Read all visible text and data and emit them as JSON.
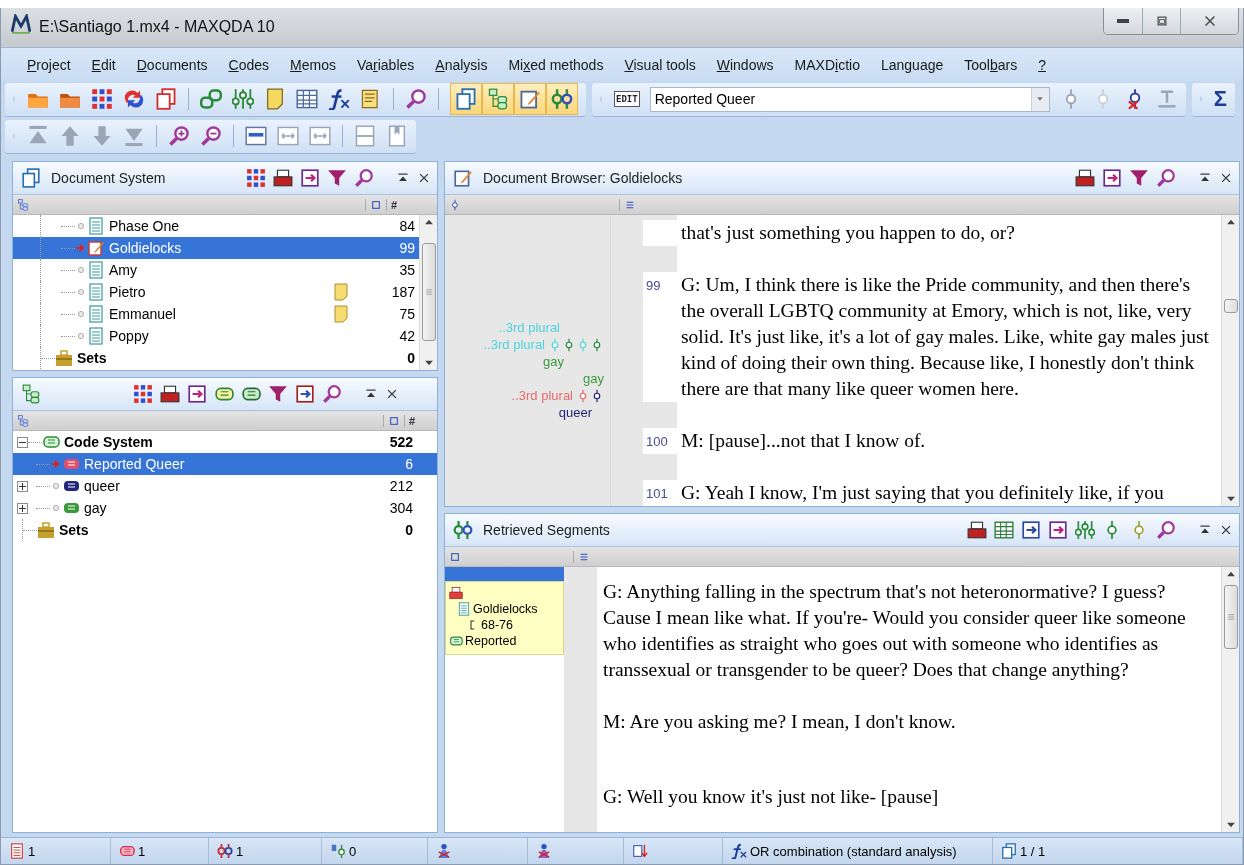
{
  "window": {
    "title": "E:\\Santiago 1.mx4 - MAXQDA 10"
  },
  "menu": [
    {
      "key": "P",
      "after": "roject"
    },
    {
      "key": "E",
      "after": "dit"
    },
    {
      "key": "D",
      "after": "ocuments"
    },
    {
      "key": "C",
      "after": "odes"
    },
    {
      "key": "M",
      "after": "emos"
    },
    {
      "before": "Va",
      "key": "r",
      "after": "iables"
    },
    {
      "key": "A",
      "after": "nalysis"
    },
    {
      "before": "Mi",
      "key": "x",
      "after": "ed methods"
    },
    {
      "key": "V",
      "after": "isual tools"
    },
    {
      "key": "W",
      "after": "indows"
    },
    {
      "before": "MAXD",
      "key": "i",
      "after": "ctio"
    },
    {
      "before": "Lan",
      "key": "g",
      "after": "uage"
    },
    {
      "before": "Tool",
      "key": "b",
      "after": "ars"
    },
    {
      "key": "?"
    }
  ],
  "toolbar": {
    "window_toggles": [
      {
        "on": true
      },
      {
        "on": true
      },
      {
        "on": true
      },
      {
        "on": true
      }
    ],
    "edit_badge": "EDIT",
    "active_code": "Reported Queer",
    "sigma": "Σ"
  },
  "document_system": {
    "title": "Document System",
    "count_header": "#",
    "items": [
      {
        "name": "Phase One",
        "count": "84",
        "selected": false,
        "memo": false
      },
      {
        "name": "Goldielocks",
        "count": "99",
        "selected": true,
        "memo": false
      },
      {
        "name": "Amy",
        "count": "35",
        "selected": false,
        "memo": false
      },
      {
        "name": "Pietro",
        "count": "187",
        "selected": false,
        "memo": true
      },
      {
        "name": "Emmanuel",
        "count": "75",
        "selected": false,
        "memo": true
      },
      {
        "name": "Poppy",
        "count": "42",
        "selected": false,
        "memo": false
      }
    ],
    "sets": {
      "name": "Sets",
      "count": "0"
    }
  },
  "code_system": {
    "count_header": "#",
    "root": {
      "name": "Code System",
      "count": "522",
      "expanded": true
    },
    "codes": [
      {
        "name": "Reported Queer",
        "count": "6",
        "selected": true,
        "color": "#e0506e"
      },
      {
        "name": "queer",
        "count": "212",
        "selected": false,
        "expanded": false,
        "color": "#24247a"
      },
      {
        "name": "gay",
        "count": "304",
        "selected": false,
        "expanded": false,
        "color": "#3a9a3a"
      }
    ],
    "sets": {
      "name": "Sets",
      "count": "0"
    }
  },
  "document_browser": {
    "title": "Document Browser: Goldielocks",
    "margin_marks": [
      {
        "label": "..3rd plural",
        "color": "#4fd3dc"
      },
      {
        "label": "..3rd plural",
        "color": "#4fd3dc",
        "symbols": [
          {
            "color": "#4fd3dc"
          },
          {
            "color": "#1f8a3a"
          },
          {
            "color": "#4fd3dc"
          },
          {
            "color": "#1f8a3a"
          }
        ]
      },
      {
        "label": "gay",
        "color": "#3a9a3a"
      },
      {
        "label": "gay",
        "color": "#3a9a3a"
      },
      {
        "label": "..3rd plural",
        "color": "#e86a6a",
        "symbols": [
          {
            "color": "#e86a6a"
          },
          {
            "color": "#24247a"
          }
        ]
      },
      {
        "label": "queer",
        "color": "#24247a"
      }
    ],
    "paragraphs": [
      {
        "text": "that's just something you happen to do, or?"
      },
      {
        "number": "99",
        "text": "G: Um, I think there is like the Pride community, and then there's the overall LGBTQ community at Emory, which is not, like, very solid. It's just like, it's a lot of gay males. Like, white gay males just kind of doing their own thing. Because like, I honestly don't think there are that many like queer women here."
      },
      {
        "number": "100",
        "text": "M: [pause]...not that I know of."
      },
      {
        "number": "101",
        "text": "G: Yeah I know, I'm just saying that you definitely like, if you"
      }
    ]
  },
  "retrieved_segments": {
    "title": "Retrieved Segments",
    "source": {
      "document": "Goldielocks",
      "range": "68-76",
      "code": "Reported"
    },
    "paragraphs": [
      "G: Anything falling in the spectrum that's not heteronormative? I guess? Cause I mean like what. If you're- Would you consider queer like someone who identifies as straight who goes out with someone who identifies as transsexual or transgender to be queer? Does that change anything?",
      "M:  Are you asking me? I mean, I don't know.",
      "G: Well you know it's just not like- [pause]"
    ]
  },
  "status_bar": [
    {
      "kind": "documents",
      "text": "1"
    },
    {
      "kind": "codes",
      "text": "1"
    },
    {
      "kind": "segments",
      "text": "1"
    },
    {
      "kind": "weights",
      "text": "0"
    },
    {
      "kind": "activation"
    },
    {
      "kind": "deactivation"
    },
    {
      "kind": "order"
    },
    {
      "kind": "formula",
      "text": "OR combination (standard analysis)"
    },
    {
      "kind": "windows",
      "text": "1 / 1"
    }
  ]
}
